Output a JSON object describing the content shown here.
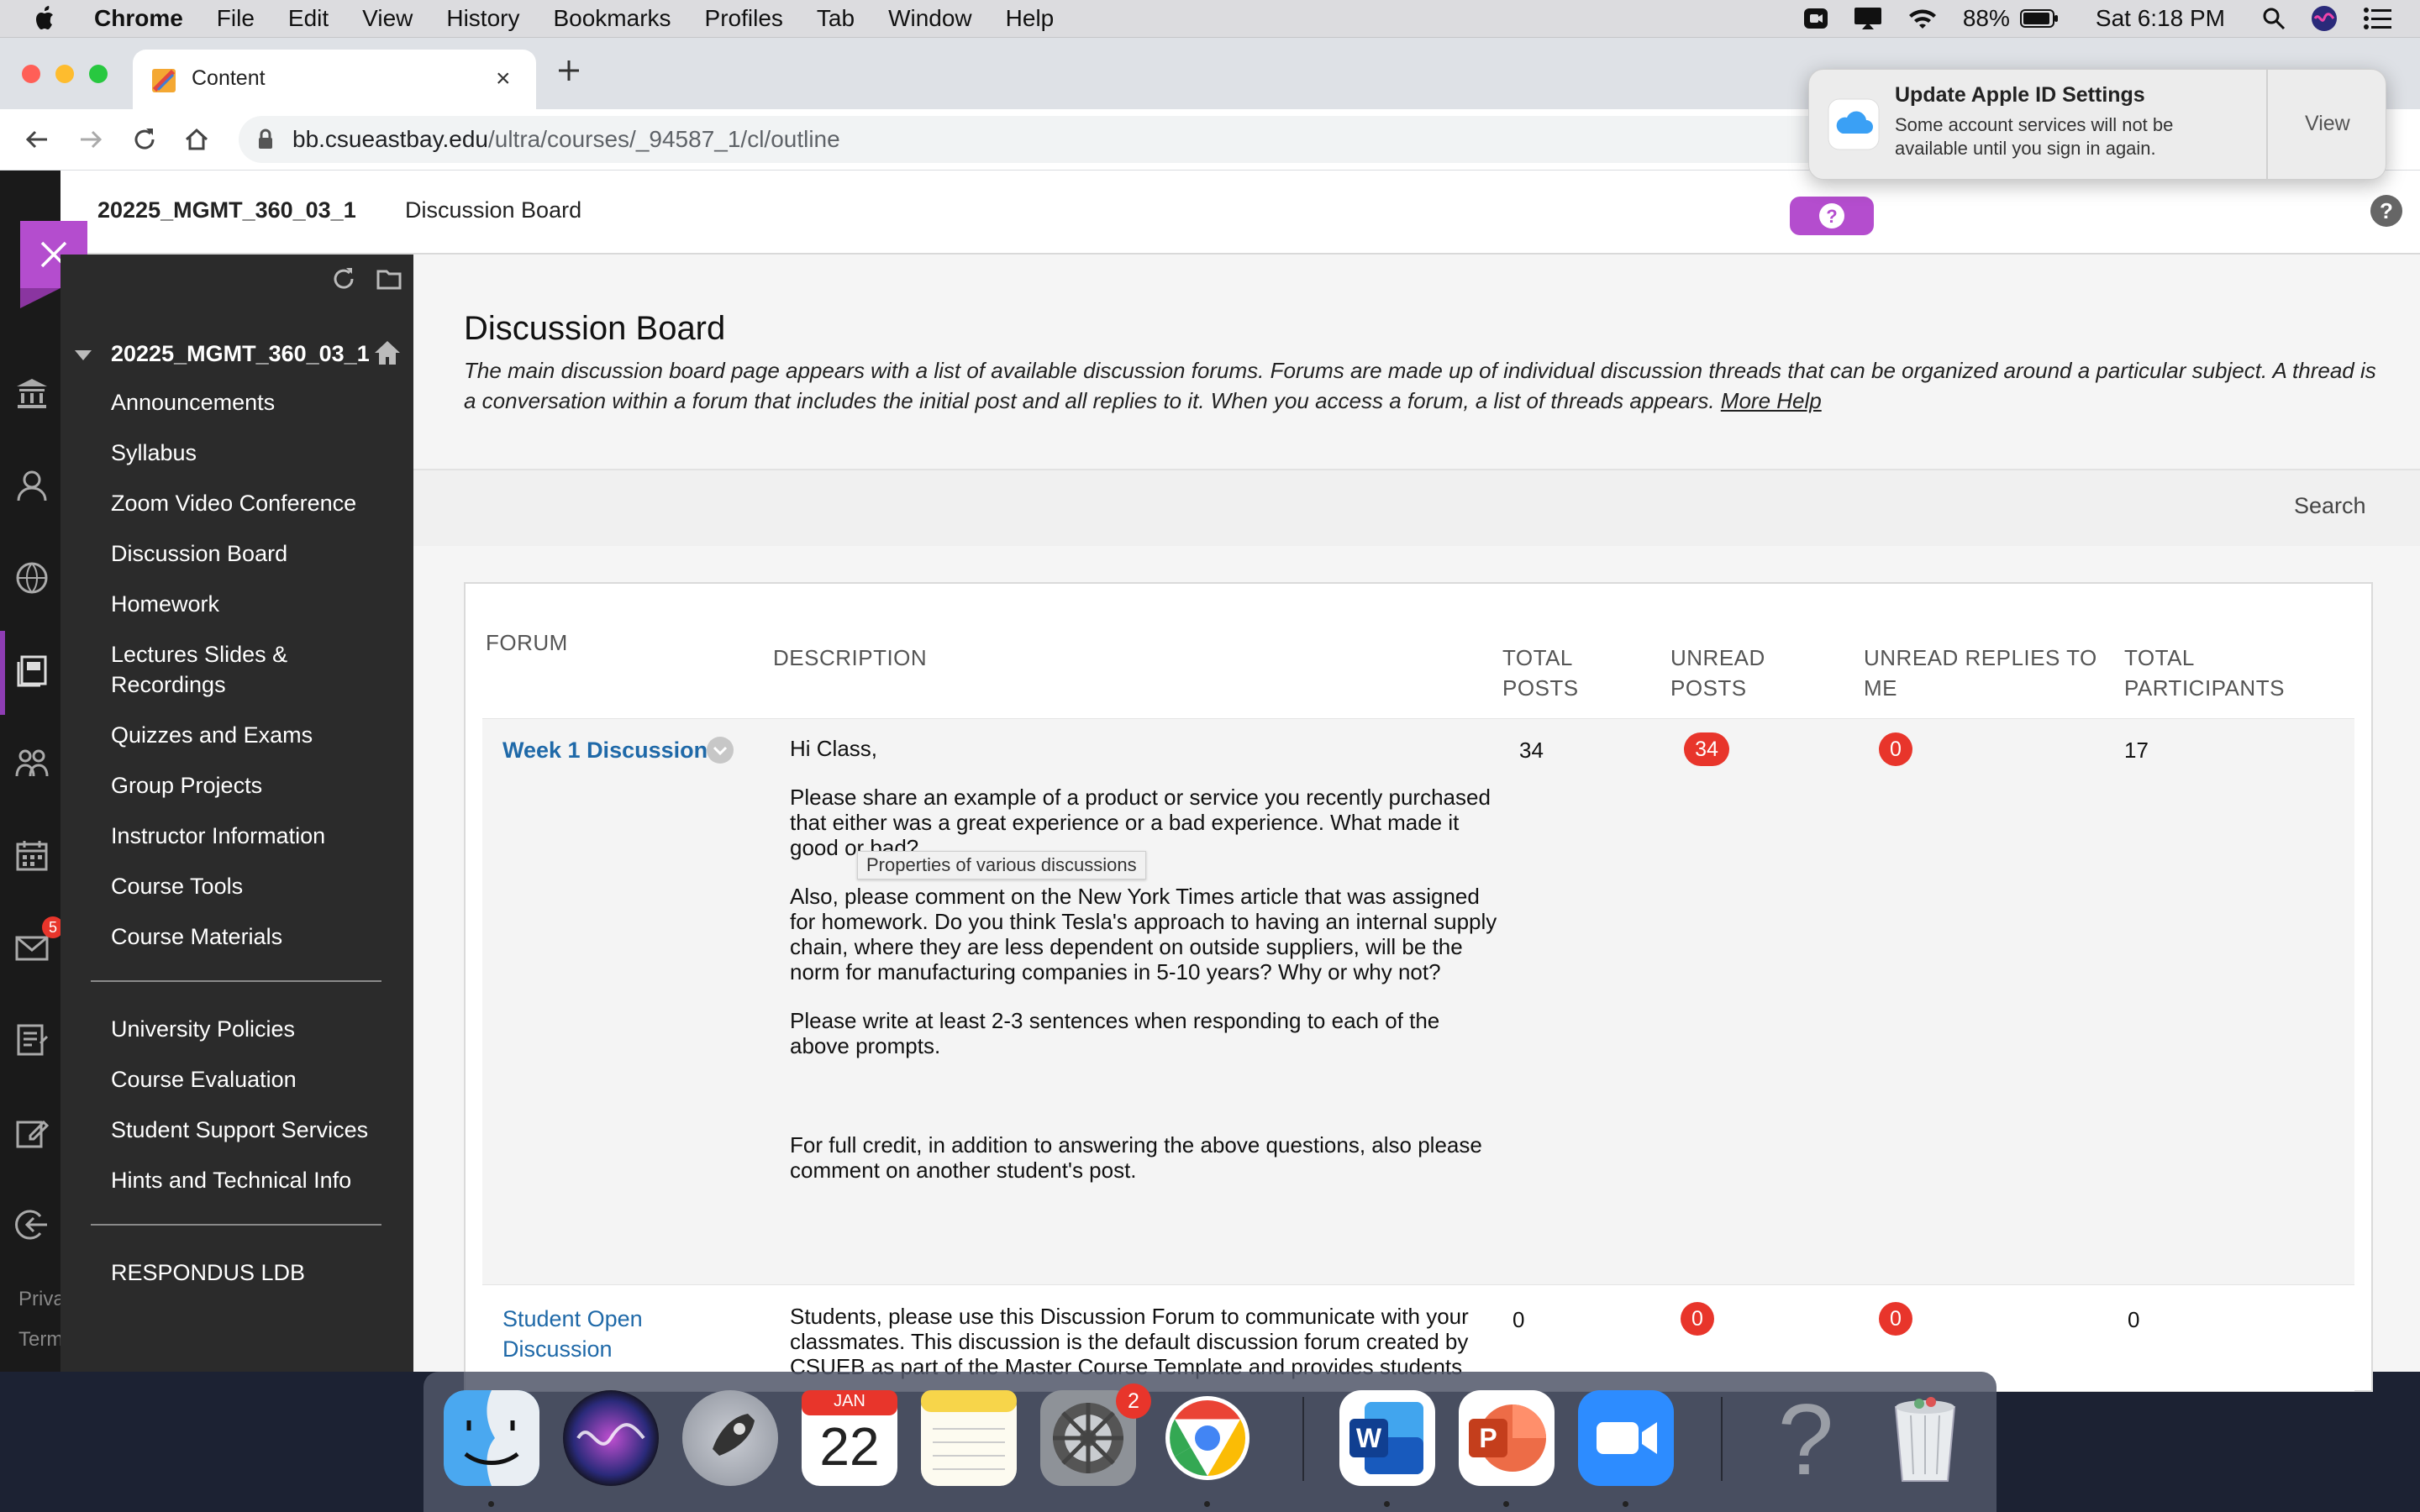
{
  "menubar": {
    "app": "Chrome",
    "items": [
      "File",
      "Edit",
      "View",
      "History",
      "Bookmarks",
      "Profiles",
      "Tab",
      "Window",
      "Help"
    ],
    "battery": "88%",
    "clock": "Sat 6:18 PM"
  },
  "browser": {
    "tab_title": "Content",
    "url_domain": "bb.csueastbay.edu",
    "url_path": "/ultra/courses/_94587_1/cl/outline"
  },
  "notification": {
    "title": "Update Apple ID Settings",
    "body": "Some account services will not be available until you sign in again.",
    "action": "View"
  },
  "course_header": {
    "course_id": "20225_MGMT_360_03_1",
    "page": "Discussion Board"
  },
  "sidebar_footer": {
    "privacy": "Priva",
    "terms": "Term"
  },
  "course_menu": {
    "title": "20225_MGMT_360_03_1",
    "group1": [
      "Announcements",
      "Syllabus",
      "Zoom Video Conference",
      "Discussion Board",
      "Homework",
      "Lectures Slides & Recordings",
      "Quizzes and Exams",
      "Group Projects",
      "Instructor Information",
      "Course Tools",
      "Course Materials"
    ],
    "group2": [
      "University Policies",
      "Course Evaluation",
      "Student Support Services",
      "Hints and Technical Info"
    ],
    "group3": [
      "RESPONDUS LDB"
    ]
  },
  "main": {
    "title": "Discussion Board",
    "intro": "The main discussion board page appears with a list of available discussion forums. Forums are made up of individual discussion threads that can be organized around a particular subject. A thread is a conversation within a forum that includes the initial post and all replies to it. When you access a forum, a list of threads appears.",
    "more_help": "More Help",
    "search": "Search",
    "tooltip": "Properties of various discussions"
  },
  "table": {
    "headers": {
      "forum": "FORUM",
      "description": "DESCRIPTION",
      "total_posts": [
        "TOTAL",
        "POSTS"
      ],
      "unread_posts": [
        "UNREAD",
        "POSTS"
      ],
      "unread_replies": [
        "UNREAD REPLIES TO",
        "ME"
      ],
      "total_participants": [
        "TOTAL",
        "PARTICIPANTS"
      ]
    },
    "rows": [
      {
        "forum": "Week 1 Discussion",
        "description": [
          "Hi Class,",
          "Please share an example of a product or service you recently purchased that either was a great experience or a bad experience. What made it good or bad?",
          "Also, please comment on the New York Times article that was assigned for homework.  Do you think Tesla's approach to having an internal supply chain, where they are less dependent on outside suppliers, will be the norm for manufacturing companies in 5-10 years?  Why or why not?",
          "Please write at least 2-3 sentences when responding to each of the above prompts.",
          "For full credit, in addition to answering the above questions, also please comment on another student's post."
        ],
        "total_posts": "34",
        "unread_posts": "34",
        "unread_replies": "0",
        "participants": "17"
      },
      {
        "forum": "Student Open Discussion",
        "description": "Students, please use this Discussion Forum to communicate with your classmates. This discussion is the default discussion forum created by CSUEB as part of the Master Course Template and provides students",
        "total_posts": "0",
        "unread_posts": "0",
        "unread_replies": "0",
        "participants": "0"
      }
    ]
  },
  "dock": {
    "calendar_month": "JAN",
    "calendar_day": "22",
    "prefs_badge": "2",
    "mail_badge": "5",
    "apps": [
      "finder",
      "siri",
      "launchpad",
      "calendar",
      "notes",
      "system-preferences",
      "chrome",
      "word",
      "powerpoint",
      "zoom",
      "help",
      "trash"
    ]
  }
}
